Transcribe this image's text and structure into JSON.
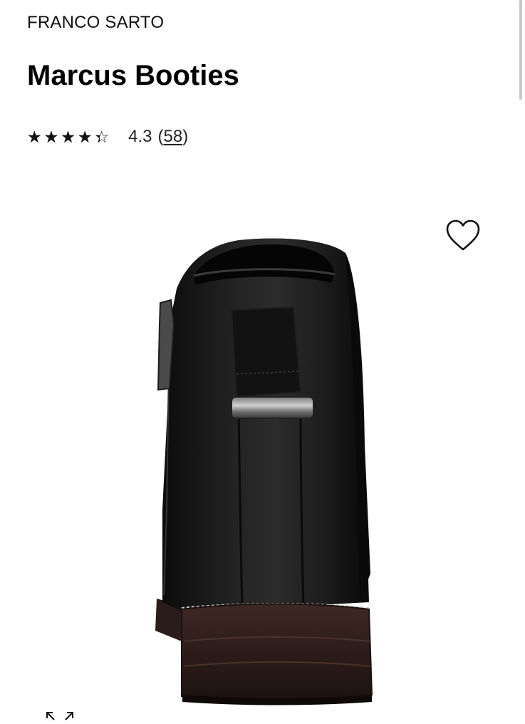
{
  "product": {
    "brand": "FRANCO SARTO",
    "name": "Marcus Booties",
    "rating": {
      "value_text": "4.3",
      "value": 4.3,
      "max": 5,
      "open_paren": "(",
      "count": "58",
      "close_paren": ")"
    }
  },
  "icons": {
    "wishlist": "heart-outline-icon",
    "expand": "expand-arrows-icon"
  },
  "colors": {
    "text": "#111111",
    "boot": "#131313",
    "heel": "#3a2420"
  }
}
